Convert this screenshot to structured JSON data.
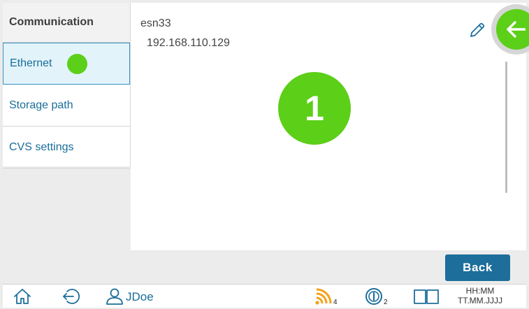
{
  "sidebar": {
    "header": "Communication",
    "items": [
      {
        "label": "Ethernet",
        "active": true
      },
      {
        "label": "Storage path",
        "active": false
      },
      {
        "label": "CVS settings",
        "active": false
      }
    ]
  },
  "content": {
    "network_name": "esn33",
    "ip_address": "192.168.110.129",
    "step_number": "1"
  },
  "actions": {
    "back_label": "Back"
  },
  "status_bar": {
    "user": "JDoe",
    "wifi_count": "4",
    "sensor_count": "2",
    "time": "HH:MM",
    "date": "TT.MM.JJJJ"
  },
  "colors": {
    "accent_green": "#5ccf18",
    "primary_blue": "#1d6e9b",
    "text_blue": "#1a6d9a",
    "wifi_orange": "#f2a21b"
  }
}
